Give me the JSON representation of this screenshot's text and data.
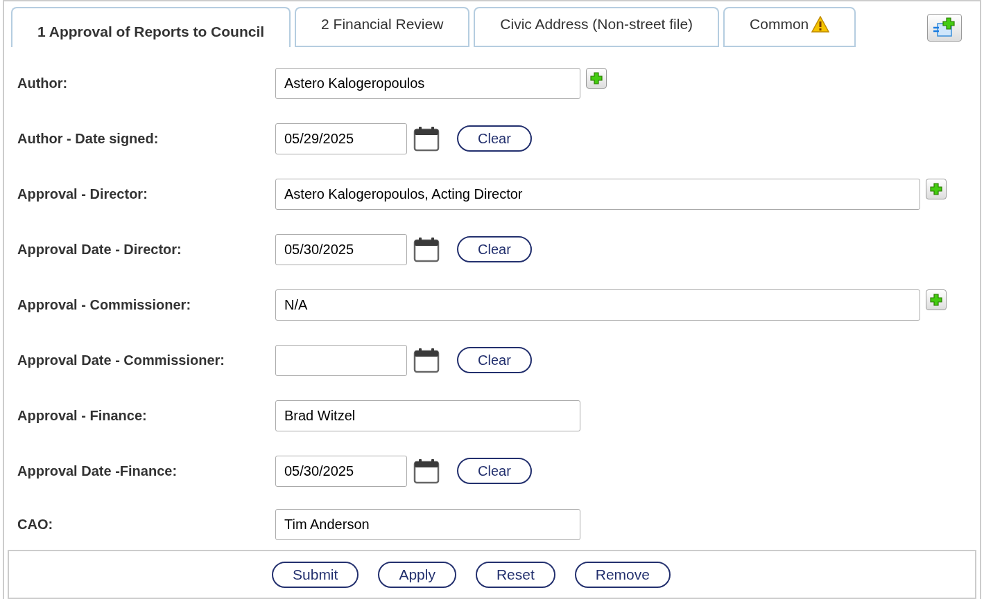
{
  "tabs": [
    {
      "label": "1 Approval of Reports to Council",
      "selected": true,
      "warning": false
    },
    {
      "label": "2 Financial Review",
      "selected": false,
      "warning": false
    },
    {
      "label": "Civic Address (Non-street file)",
      "selected": false,
      "warning": false
    },
    {
      "label": "Common",
      "selected": false,
      "warning": true
    }
  ],
  "fields": [
    {
      "kind": "lookup",
      "label": "Author:",
      "value": "Astero Kalogeropoulos",
      "wide": false
    },
    {
      "kind": "date",
      "label": "Author - Date signed:",
      "value": "05/29/2025",
      "button": "Clear"
    },
    {
      "kind": "lookup",
      "label": "Approval - Director:",
      "value": "Astero Kalogeropoulos, Acting Director",
      "wide": true
    },
    {
      "kind": "date",
      "label": "Approval Date - Director:",
      "value": "05/30/2025",
      "button": "Clear"
    },
    {
      "kind": "lookup",
      "label": "Approval - Commissioner:",
      "value": "N/A",
      "wide": true
    },
    {
      "kind": "date",
      "label": "Approval Date - Commissioner:",
      "button": "Clear"
    },
    {
      "kind": "text",
      "label": "Approval - Finance:",
      "value": "Brad Witzel",
      "wide": false
    },
    {
      "kind": "date",
      "label": "Approval Date -Finance:",
      "value": "05/30/2025",
      "button": "Clear"
    },
    {
      "kind": "text",
      "label": "CAO:",
      "value": "Tim Anderson",
      "wide": false
    }
  ],
  "actions": [
    "Submit",
    "Apply",
    "Reset",
    "Remove"
  ]
}
